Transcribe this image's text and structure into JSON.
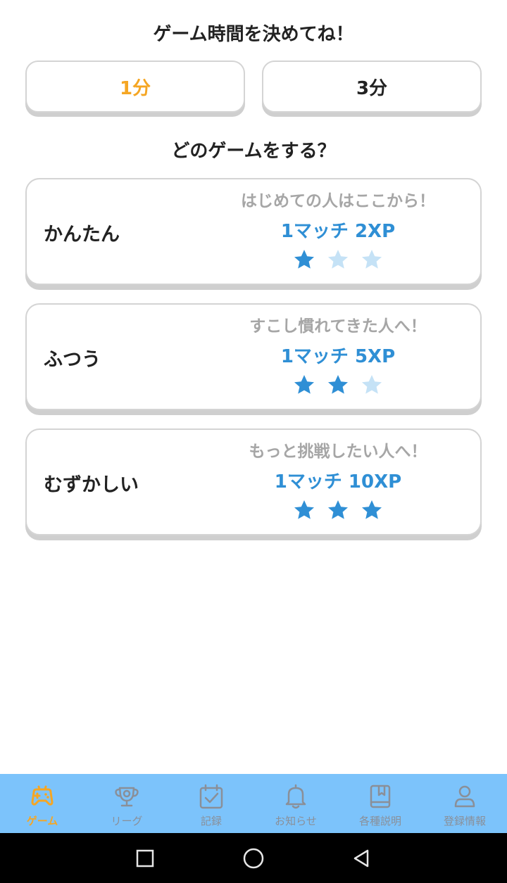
{
  "time_section": {
    "title": "ゲーム時間を決めてね！",
    "options": [
      {
        "label": "1分",
        "selected": true
      },
      {
        "label": "3分",
        "selected": false
      }
    ]
  },
  "game_section": {
    "title": "どのゲームをする？",
    "modes": [
      {
        "name": "かんたん",
        "description": "はじめての人はここから！",
        "xp": "1マッチ 2XP",
        "stars": 1,
        "max_stars": 3
      },
      {
        "name": "ふつう",
        "description": "すこし慣れてきた人へ！",
        "xp": "1マッチ 5XP",
        "stars": 2,
        "max_stars": 3
      },
      {
        "name": "むずかしい",
        "description": "もっと挑戦したい人へ！",
        "xp": "1マッチ 10XP",
        "stars": 3,
        "max_stars": 3
      }
    ]
  },
  "bottom_nav": {
    "items": [
      {
        "label": "ゲーム",
        "icon": "gamepad-icon",
        "active": true
      },
      {
        "label": "リーグ",
        "icon": "trophy-icon",
        "active": false
      },
      {
        "label": "記録",
        "icon": "calendar-check-icon",
        "active": false
      },
      {
        "label": "お知らせ",
        "icon": "bell-icon",
        "active": false
      },
      {
        "label": "各種説明",
        "icon": "book-icon",
        "active": false
      },
      {
        "label": "登録情報",
        "icon": "user-icon",
        "active": false
      }
    ]
  },
  "colors": {
    "accent_orange": "#f5a623",
    "xp_blue": "#2f8fd5",
    "star_filled": "#2f8fd5",
    "star_empty": "#c5e2f6",
    "nav_background": "#7cc3fb",
    "nav_inactive": "#8a8f98"
  }
}
